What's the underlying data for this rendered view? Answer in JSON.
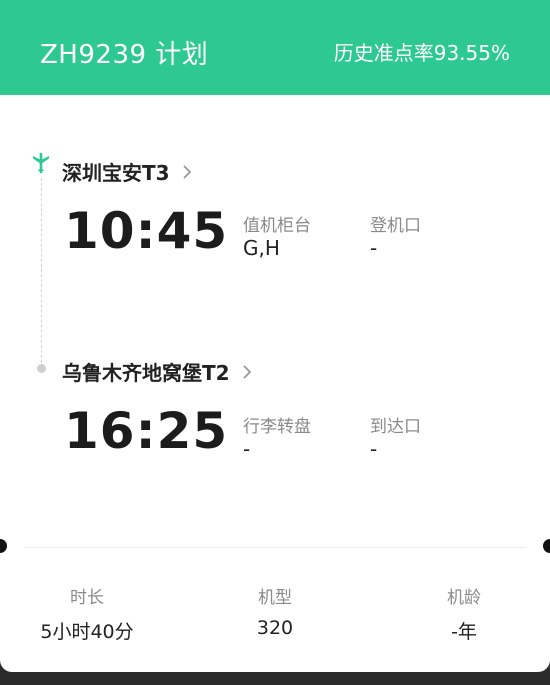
{
  "header": {
    "flight_title": "ZH9239 计划",
    "ontime_rate": "历史准点率93.55%"
  },
  "departure": {
    "airport": "深圳宝安T3",
    "time": "10:45",
    "counter_label": "值机柜台",
    "counter_value": "G,H",
    "gate_label": "登机口",
    "gate_value": "-"
  },
  "arrival": {
    "airport": "乌鲁木齐地窝堡T2",
    "time": "16:25",
    "baggage_label": "行李转盘",
    "baggage_value": "-",
    "exit_label": "到达口",
    "exit_value": "-"
  },
  "stats": {
    "duration_label": "时长",
    "duration_value": "5小时40分",
    "aircraft_label": "机型",
    "aircraft_value": "320",
    "age_label": "机龄",
    "age_value": "-年"
  },
  "icons": {
    "departure": "plane-takeoff-icon",
    "airport_link": "chevron-right-icon"
  },
  "colors": {
    "brand": "#2ec990",
    "label": "#8a8a8a",
    "text": "#222222"
  }
}
